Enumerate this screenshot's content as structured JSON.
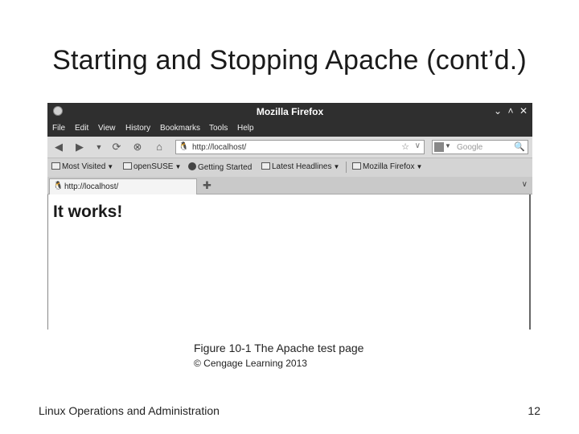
{
  "slide": {
    "title": "Starting and Stopping Apache (cont’d.)",
    "caption": "Figure 10-1 The Apache test page",
    "copyright": "© Cengage Learning 2013",
    "footer": "Linux Operations and Administration",
    "page_number": "12"
  },
  "browser": {
    "window_title": "Mozilla Firefox",
    "menu": [
      "File",
      "Edit",
      "View",
      "History",
      "Bookmarks",
      "Tools",
      "Help"
    ],
    "url": "http://localhost/",
    "search_placeholder": "Google",
    "bookmarks": [
      "Most Visited",
      "openSUSE",
      "Getting Started",
      "Latest Headlines",
      "Mozilla Firefox"
    ],
    "tab_title": "http://localhost/",
    "page_heading": "It works!"
  }
}
